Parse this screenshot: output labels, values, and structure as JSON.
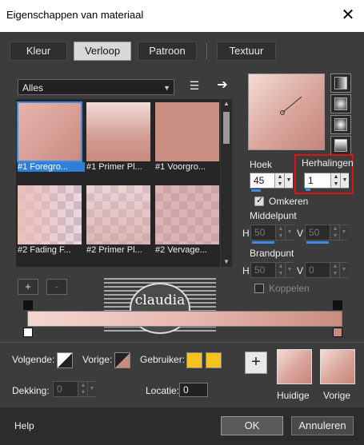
{
  "window": {
    "title": "Eigenschappen van materiaal",
    "close_glyph": "✕"
  },
  "tabs": [
    {
      "label": "Kleur",
      "active": false
    },
    {
      "label": "Verloop",
      "active": true
    },
    {
      "label": "Patroon",
      "active": false
    },
    {
      "label": "Textuur",
      "active": false
    }
  ],
  "category": {
    "value": "Alles",
    "arrow": "▼"
  },
  "thumbnails": [
    {
      "label": "#1 Foregro...",
      "selected": true
    },
    {
      "label": "#1 Primer Pl..."
    },
    {
      "label": "#1 Voorgro..."
    },
    {
      "label": "#2 Fading F..."
    },
    {
      "label": "#2 Primer Pl..."
    },
    {
      "label": "#2 Vervage..."
    }
  ],
  "controls": {
    "hoek_label": "Hoek",
    "hoek_value": "45",
    "herhalingen_label": "Herhalingen",
    "herhalingen_value": "1",
    "omkeren_label": "Omkeren",
    "omkeren_checked": true,
    "middelpunt_label": "Middelpunt",
    "h_label": "H",
    "v_label": "V",
    "middelpunt_h": "50",
    "middelpunt_v": "50",
    "brandpunt_label": "Brandpunt",
    "brandpunt_h": "50",
    "brandpunt_v": "0",
    "koppelen_label": "Koppelen"
  },
  "editor": {
    "add_label": "+",
    "remove_label": "-",
    "watermark_text": "claudia"
  },
  "color_row": {
    "volgende_label": "Volgende:",
    "vorige_label": "Vorige:",
    "gebruiker_label": "Gebruiker:",
    "dekking_label": "Dekking:",
    "dekking_value": "0",
    "locatie_label": "Locatie:",
    "locatie_value": "0",
    "user_color": "#f5c320"
  },
  "preview_boxes": {
    "plus": "+",
    "huidige_label": "Huidige",
    "vorige_label": "Vorige"
  },
  "footer": {
    "help_label": "Help",
    "ok_label": "OK",
    "cancel_label": "Annuleren"
  },
  "icons": {
    "up": "▲",
    "down": "▼",
    "arrow_right": "➔",
    "menu": "☰"
  }
}
